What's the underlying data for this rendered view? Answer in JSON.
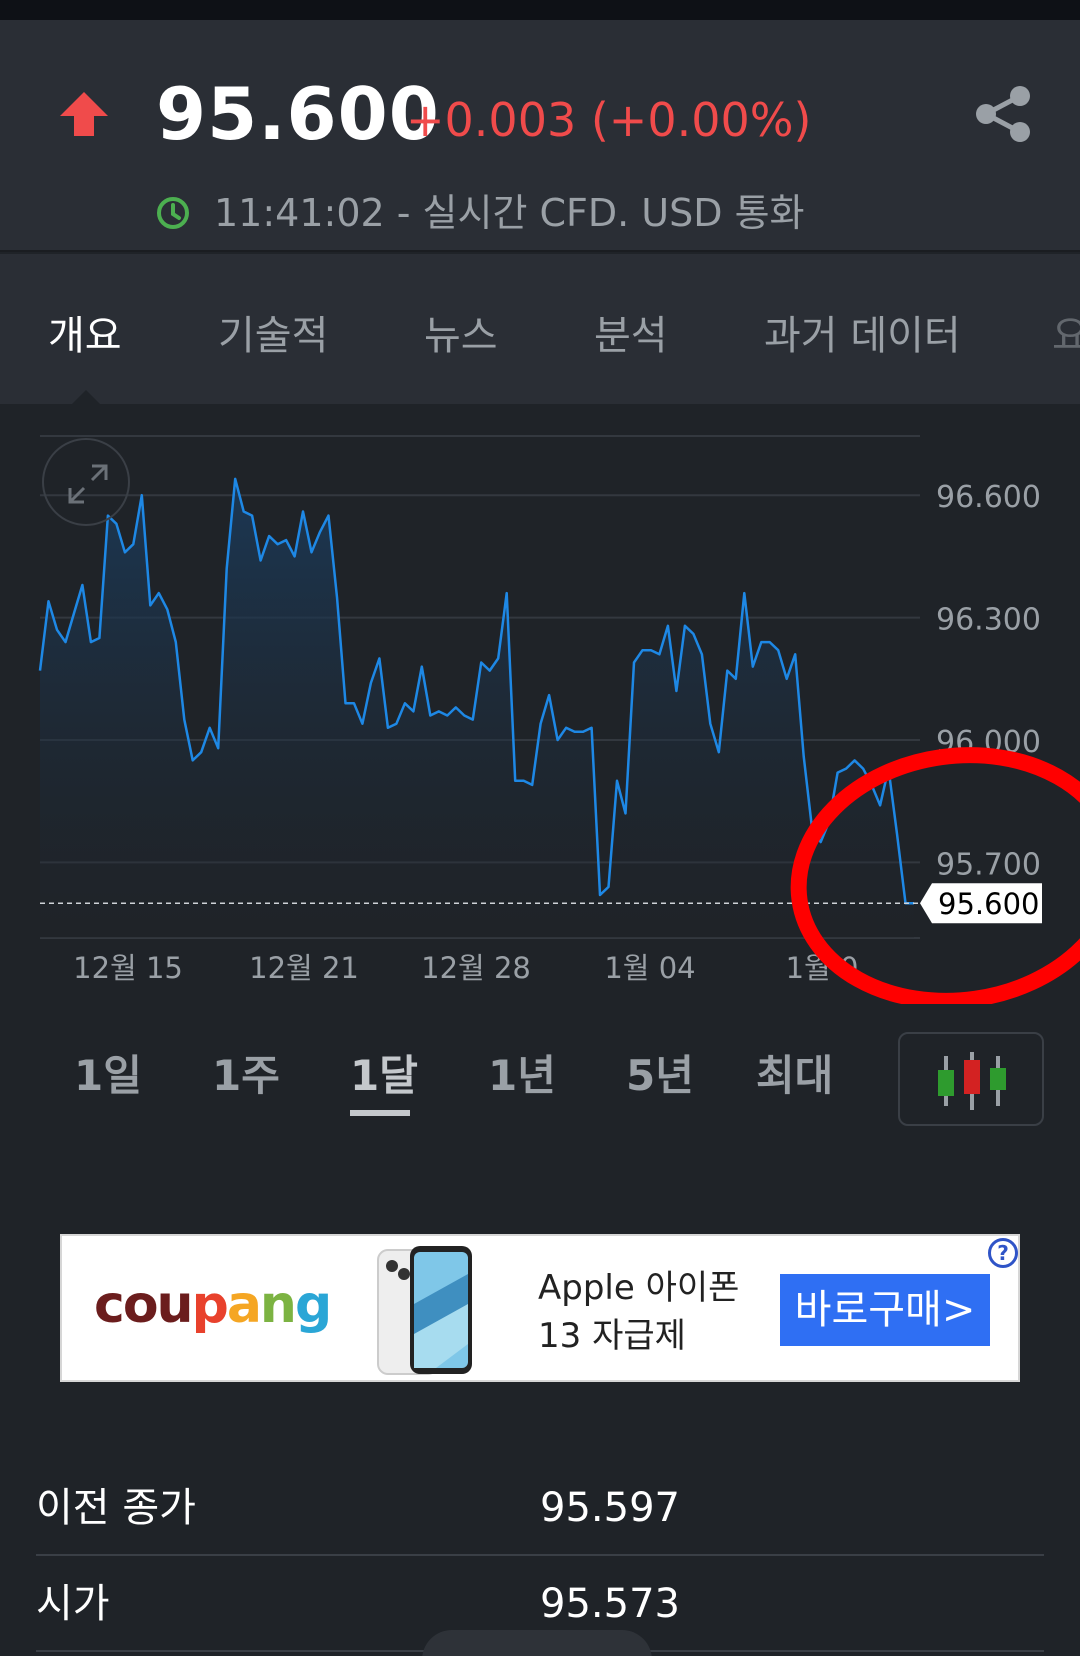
{
  "quote": {
    "price": "95.600",
    "change": "+0.003 (+0.00%)",
    "direction_icon": "arrow-up-icon",
    "realtime_note": "11:41:02 - 실시간 CFD. USD 통화"
  },
  "tabs": [
    {
      "label": "개요",
      "active": true
    },
    {
      "label": "기술적"
    },
    {
      "label": "뉴스"
    },
    {
      "label": "분석"
    },
    {
      "label": "과거 데이터"
    },
    {
      "label": "요"
    }
  ],
  "chart_data": {
    "type": "area",
    "x_ticks": [
      "12월 15",
      "12월 21",
      "12월 28",
      "1월 04",
      "1월 0"
    ],
    "y_ticks": [
      96.6,
      96.3,
      96.0,
      95.7
    ],
    "y_tick_labels": [
      "96.600",
      "96.300",
      "96.000",
      "95.700"
    ],
    "ylim": [
      95.5,
      96.75
    ],
    "current_value": 95.6,
    "current_value_label": "95.600",
    "line_color": "#1e88e5",
    "grid": true,
    "series": [
      {
        "values": [
          96.17,
          96.34,
          96.27,
          96.24,
          96.31,
          96.38,
          96.24,
          96.25,
          96.55,
          96.53,
          96.46,
          96.48,
          96.6,
          96.33,
          96.36,
          96.32,
          96.24,
          96.05,
          95.95,
          95.97,
          96.03,
          95.98,
          96.42,
          96.64,
          96.56,
          96.55,
          96.44,
          96.5,
          96.48,
          96.49,
          96.45,
          96.56,
          96.46,
          96.51,
          96.55,
          96.35,
          96.09,
          96.09,
          96.04,
          96.14,
          96.2,
          96.03,
          96.04,
          96.09,
          96.07,
          96.18,
          96.06,
          96.07,
          96.06,
          96.08,
          96.06,
          96.05,
          96.19,
          96.17,
          96.2,
          96.36,
          95.9,
          95.9,
          95.89,
          96.04,
          96.11,
          96.0,
          96.03,
          96.02,
          96.02,
          96.03,
          95.62,
          95.64,
          95.9,
          95.82,
          96.19,
          96.22,
          96.22,
          96.21,
          96.28,
          96.12,
          96.28,
          96.26,
          96.21,
          96.04,
          95.97,
          96.17,
          96.15,
          96.36,
          96.18,
          96.24,
          96.24,
          96.22,
          96.15,
          96.21,
          95.96,
          95.78,
          95.75,
          95.8,
          95.92,
          95.93,
          95.95,
          95.93,
          95.89,
          95.84,
          95.93,
          95.77,
          95.6,
          95.6
        ]
      }
    ]
  },
  "time_ranges": [
    {
      "label": "1일"
    },
    {
      "label": "1주"
    },
    {
      "label": "1달",
      "active": true
    },
    {
      "label": "1년"
    },
    {
      "label": "5년"
    },
    {
      "label": "최대"
    }
  ],
  "ad": {
    "brand": "coupang",
    "line1": "Apple 아이폰",
    "line2": "13 자급제",
    "cta": "바로구매>",
    "help": "?"
  },
  "stats": [
    {
      "label": "이전 종가",
      "value": "95.597"
    },
    {
      "label": "시가",
      "value": "95.573"
    }
  ],
  "colors": {
    "up": "#f04b4b",
    "realtime": "#4caf50",
    "line": "#1e88e5",
    "annotation": "#ff0000"
  }
}
